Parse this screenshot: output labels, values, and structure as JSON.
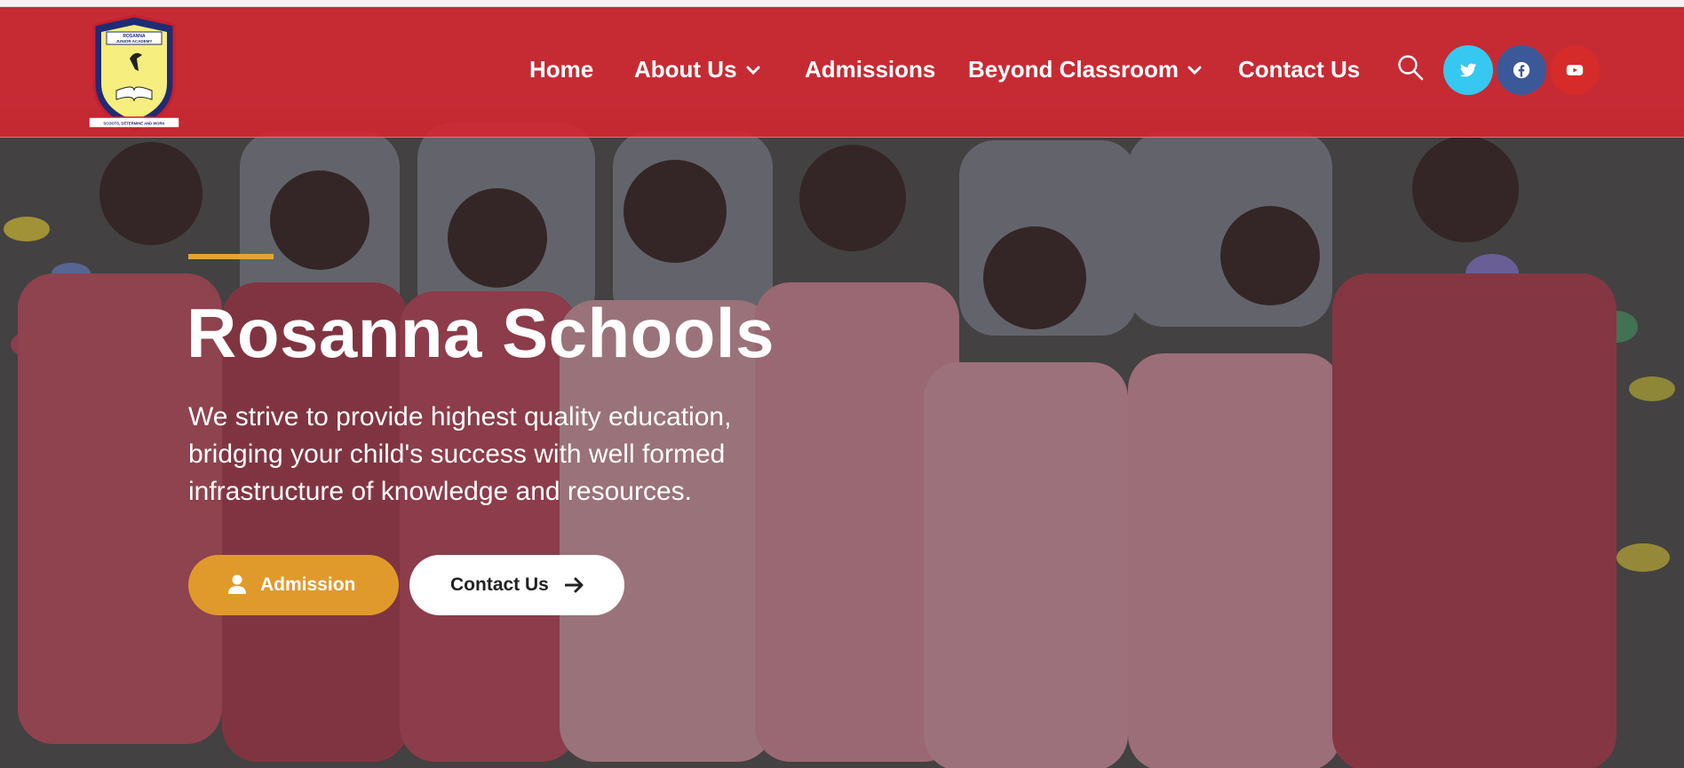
{
  "brand": {
    "logo_text_top": "ROSANNA",
    "logo_text_mid": "JUNIOR ACADEMY",
    "logo_motto": "SCOOTS, DETERMINE AND WORK",
    "logo_name": "crest-logo"
  },
  "nav": {
    "items": [
      {
        "label": "Home",
        "has_dropdown": false
      },
      {
        "label": "About Us",
        "has_dropdown": true
      },
      {
        "label": "Admissions",
        "has_dropdown": false
      },
      {
        "label": "Beyond Classroom",
        "has_dropdown": true
      },
      {
        "label": "Contact Us",
        "has_dropdown": false
      }
    ],
    "search_icon": "search-icon",
    "social": [
      {
        "name": "twitter",
        "icon": "twitter-icon",
        "color": "#36c8f0"
      },
      {
        "name": "facebook",
        "icon": "facebook-icon",
        "color": "#3b5998"
      },
      {
        "name": "youtube",
        "icon": "youtube-icon",
        "color": "#d52b2b"
      }
    ]
  },
  "hero": {
    "title": "Rosanna Schools",
    "subtitle": "We strive to provide highest quality education, bridging your child's success with well formed infrastructure of knowledge and resources.",
    "primary_button": {
      "label": "Admission",
      "icon": "user-icon"
    },
    "secondary_button": {
      "label": "Contact Us",
      "icon": "arrow-right-icon"
    }
  },
  "colors": {
    "header_red": "#d62530",
    "accent_gold": "#e2a43a",
    "button_gold": "#e09a2c"
  }
}
